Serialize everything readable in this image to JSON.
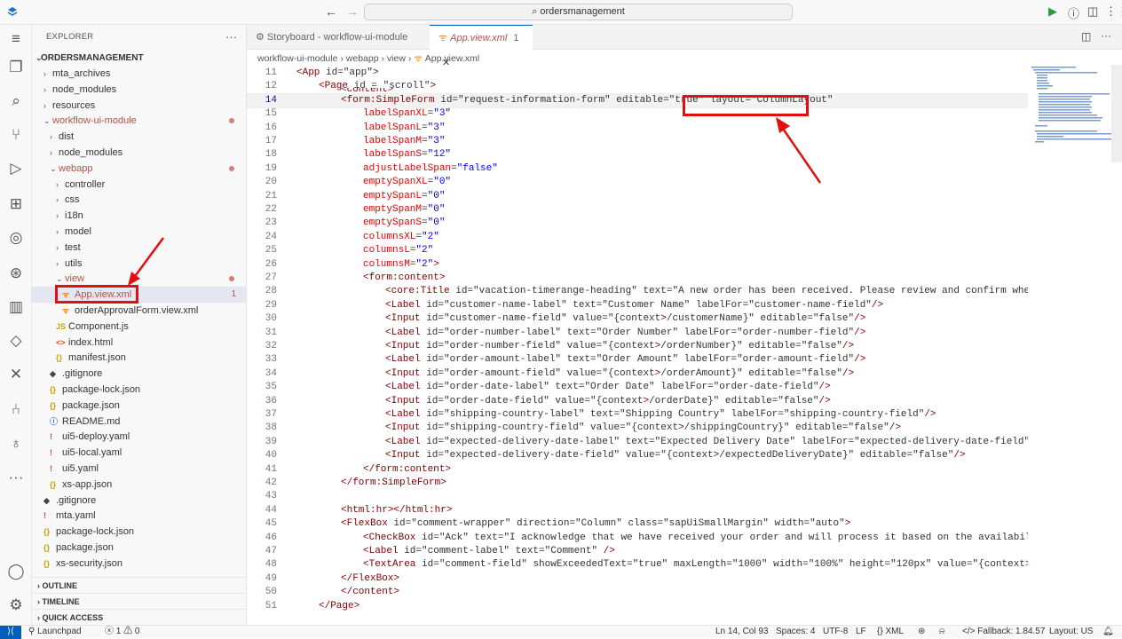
{
  "titlebar": {
    "search": "ordersmanagement"
  },
  "explorer": {
    "title": "EXPLORER",
    "root": "ORDERSMANAGEMENT",
    "items": [
      {
        "label": "mta_archives",
        "indent": 1,
        "type": "folder",
        "state": "closed"
      },
      {
        "label": "node_modules",
        "indent": 1,
        "type": "folder",
        "state": "closed"
      },
      {
        "label": "resources",
        "indent": 1,
        "type": "folder",
        "state": "closed"
      },
      {
        "label": "workflow-ui-module",
        "indent": 1,
        "type": "folder",
        "state": "open",
        "modified": true
      },
      {
        "label": "dist",
        "indent": 2,
        "type": "folder",
        "state": "closed"
      },
      {
        "label": "node_modules",
        "indent": 2,
        "type": "folder",
        "state": "closed"
      },
      {
        "label": "webapp",
        "indent": 2,
        "type": "folder",
        "state": "open",
        "modified": true
      },
      {
        "label": "controller",
        "indent": 3,
        "type": "folder",
        "state": "closed"
      },
      {
        "label": "css",
        "indent": 3,
        "type": "folder",
        "state": "closed"
      },
      {
        "label": "i18n",
        "indent": 3,
        "type": "folder",
        "state": "closed"
      },
      {
        "label": "model",
        "indent": 3,
        "type": "folder",
        "state": "closed"
      },
      {
        "label": "test",
        "indent": 3,
        "type": "folder",
        "state": "closed"
      },
      {
        "label": "utils",
        "indent": 3,
        "type": "folder",
        "state": "closed"
      },
      {
        "label": "view",
        "indent": 3,
        "type": "folder",
        "state": "open",
        "modified": true
      },
      {
        "label": "App.view.xml",
        "indent": 4,
        "type": "xml",
        "selected": true,
        "count": "1"
      },
      {
        "label": "orderApprovalForm.view.xml",
        "indent": 4,
        "type": "xml"
      },
      {
        "label": "Component.js",
        "indent": 3,
        "type": "js"
      },
      {
        "label": "index.html",
        "indent": 3,
        "type": "html"
      },
      {
        "label": "manifest.json",
        "indent": 3,
        "type": "json"
      },
      {
        "label": ".gitignore",
        "indent": 2,
        "type": "git"
      },
      {
        "label": "package-lock.json",
        "indent": 2,
        "type": "json"
      },
      {
        "label": "package.json",
        "indent": 2,
        "type": "json"
      },
      {
        "label": "README.md",
        "indent": 2,
        "type": "info"
      },
      {
        "label": "ui5-deploy.yaml",
        "indent": 2,
        "type": "yaml"
      },
      {
        "label": "ui5-local.yaml",
        "indent": 2,
        "type": "yaml"
      },
      {
        "label": "ui5.yaml",
        "indent": 2,
        "type": "yaml"
      },
      {
        "label": "xs-app.json",
        "indent": 2,
        "type": "json"
      },
      {
        "label": ".gitignore",
        "indent": 1,
        "type": "git"
      },
      {
        "label": "mta.yaml",
        "indent": 1,
        "type": "yaml"
      },
      {
        "label": "package-lock.json",
        "indent": 1,
        "type": "json"
      },
      {
        "label": "package.json",
        "indent": 1,
        "type": "json"
      },
      {
        "label": "xs-security.json",
        "indent": 1,
        "type": "json"
      }
    ],
    "sections": [
      "OUTLINE",
      "TIMELINE",
      "QUICK ACCESS"
    ]
  },
  "tabs": [
    {
      "label": "Storyboard - workflow-ui-module",
      "active": false
    },
    {
      "label": "App.view.xml",
      "active": true,
      "count": "1"
    }
  ],
  "breadcrumb": [
    "workflow-ui-module",
    "webapp",
    "view",
    "App.view.xml"
  ],
  "code": [
    {
      "n": "11",
      "indent": 0,
      "text": "<App id=\"app\">"
    },
    {
      "n": "12",
      "indent": 1,
      "text": "<Page id = \"scroll\">"
    },
    {
      "n": "14",
      "indent": 2,
      "text": "<form:SimpleForm id=\"request-information-form\" editable=\"true\" layout=\"ColumnLayout\""
    },
    {
      "n": "15",
      "indent": 3,
      "text": "labelSpanXL=\"3\""
    },
    {
      "n": "16",
      "indent": 3,
      "text": "labelSpanL=\"3\""
    },
    {
      "n": "17",
      "indent": 3,
      "text": "labelSpanM=\"3\""
    },
    {
      "n": "18",
      "indent": 3,
      "text": "labelSpanS=\"12\""
    },
    {
      "n": "19",
      "indent": 3,
      "text": "adjustLabelSpan=\"false\""
    },
    {
      "n": "20",
      "indent": 3,
      "text": "emptySpanXL=\"0\""
    },
    {
      "n": "21",
      "indent": 3,
      "text": "emptySpanL=\"0\""
    },
    {
      "n": "22",
      "indent": 3,
      "text": "emptySpanM=\"0\""
    },
    {
      "n": "23",
      "indent": 3,
      "text": "emptySpanS=\"0\""
    },
    {
      "n": "24",
      "indent": 3,
      "text": "columnsXL=\"2\""
    },
    {
      "n": "25",
      "indent": 3,
      "text": "columnsL=\"2\""
    },
    {
      "n": "26",
      "indent": 3,
      "text": "columnsM=\"2\">"
    },
    {
      "n": "27",
      "indent": 3,
      "text": "<form:content>"
    },
    {
      "n": "28",
      "indent": 4,
      "text": "<core:Title id=\"vacation-timerange-heading\" text=\"A new order has been received. Please review and confirm whether t"
    },
    {
      "n": "29",
      "indent": 4,
      "text": "<Label id=\"customer-name-label\" text=\"Customer Name\" labelFor=\"customer-name-field\"/>"
    },
    {
      "n": "30",
      "indent": 4,
      "text": "<Input id=\"customer-name-field\" value=\"{context>/customerName}\" editable=\"false\"/>"
    },
    {
      "n": "31",
      "indent": 4,
      "text": "<Label id=\"order-number-label\" text=\"Order Number\" labelFor=\"order-number-field\"/>"
    },
    {
      "n": "32",
      "indent": 4,
      "text": "<Input id=\"order-number-field\" value=\"{context>/orderNumber}\" editable=\"false\"/>"
    },
    {
      "n": "33",
      "indent": 4,
      "text": "<Label id=\"order-amount-label\" text=\"Order Amount\" labelFor=\"order-amount-field\"/>"
    },
    {
      "n": "34",
      "indent": 4,
      "text": "<Input id=\"order-amount-field\" value=\"{context>/orderAmount}\" editable=\"false\"/>"
    },
    {
      "n": "35",
      "indent": 4,
      "text": "<Label id=\"order-date-label\" text=\"Order Date\" labelFor=\"order-date-field\"/>"
    },
    {
      "n": "36",
      "indent": 4,
      "text": "<Input id=\"order-date-field\" value=\"{context>/orderDate}\" editable=\"false\"/>"
    },
    {
      "n": "37",
      "indent": 4,
      "text": "<Label id=\"shipping-country-label\" text=\"Shipping Country\" labelFor=\"shipping-country-field\"/>"
    },
    {
      "n": "38",
      "indent": 4,
      "text": "<Input id=\"shipping-country-field\" value=\"{context>/shippingCountry}\" editable=\"false\"/>"
    },
    {
      "n": "39",
      "indent": 4,
      "text": "<Label id=\"expected-delivery-date-label\" text=\"Expected Delivery Date\" labelFor=\"expected-delivery-date-field\"/>"
    },
    {
      "n": "40",
      "indent": 4,
      "text": "<Input id=\"expected-delivery-date-field\" value=\"{context>/expectedDeliveryDate}\" editable=\"false\"/>"
    },
    {
      "n": "41",
      "indent": 3,
      "text": "</form:content>"
    },
    {
      "n": "42",
      "indent": 2,
      "text": "</form:SimpleForm>"
    },
    {
      "n": "43",
      "indent": 0,
      "text": ""
    },
    {
      "n": "44",
      "indent": 2,
      "text": "<html:hr></html:hr>"
    },
    {
      "n": "45",
      "indent": 2,
      "text": "<FlexBox id=\"comment-wrapper\" direction=\"Column\" class=\"sapUiSmallMargin\" width=\"auto\">"
    },
    {
      "n": "46",
      "indent": 3,
      "text": "<CheckBox id=\"Ack\" text=\"I acknowledge that we have received your order and will process it based on the availability\" /"
    },
    {
      "n": "47",
      "indent": 3,
      "text": "<Label id=\"comment-label\" text=\"Comment\" />"
    },
    {
      "n": "48",
      "indent": 3,
      "text": "<TextArea id=\"comment-field\" showExceededText=\"true\" maxLength=\"1000\" width=\"100%\" height=\"120px\" value=\"{context>/comme"
    },
    {
      "n": "49",
      "indent": 2,
      "text": "</FlexBox>"
    },
    {
      "n": "50",
      "indent": 2,
      "text": "</content>"
    },
    {
      "n": "51",
      "indent": 1,
      "text": "</Page>"
    }
  ],
  "sticky_fragment": "<content>",
  "highlight_text": "layout=\"ColumnLayout\"",
  "status": {
    "launchpad": "Launchpad",
    "problems": "1",
    "warnings": "0",
    "position": "Ln 14, Col 93",
    "spaces": "Spaces: 4",
    "encoding": "UTF-8",
    "eol": "LF",
    "language": "XML",
    "fallback": "Fallback: 1.84.57",
    "layout": "Layout: US"
  },
  "colors": {
    "accent": "#005fb8",
    "annotation": "#e01010",
    "modified": "#b35247"
  }
}
